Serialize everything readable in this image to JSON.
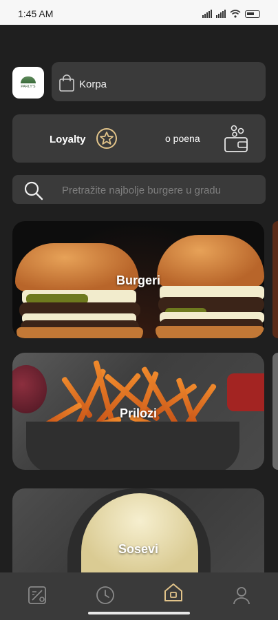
{
  "status_bar": {
    "time": "1:45 AM",
    "battery_icon": "battery-icon",
    "wifi_icon": "wifi-icon",
    "signal_icon": "signal-icon"
  },
  "header": {
    "logo": {
      "brand_text": "PARLY'S",
      "icon": "restaurant-logo"
    },
    "cart": {
      "label": "Korpa",
      "icon": "shopping-bag-icon"
    }
  },
  "loyalty": {
    "label": "Loyalty",
    "points_text": "o poena",
    "star_icon": "star-circle-icon",
    "wallet_icon": "wallet-icon"
  },
  "search": {
    "placeholder": "Pretražite najbolje burgere u gradu",
    "icon": "search-icon"
  },
  "categories": [
    {
      "title": "Burgeri"
    },
    {
      "title": "Prilozi"
    },
    {
      "title": "Sosevi"
    }
  ],
  "bottom_nav": {
    "items": [
      {
        "icon": "menu-map-icon",
        "active": false
      },
      {
        "icon": "clock-icon",
        "active": false
      },
      {
        "icon": "home-icon",
        "active": true
      },
      {
        "icon": "profile-icon",
        "active": false
      }
    ]
  },
  "colors": {
    "background": "#1f1f1f",
    "card": "#3a3a3a",
    "accent": "#e2c48a",
    "placeholder": "#7e7e7e"
  }
}
